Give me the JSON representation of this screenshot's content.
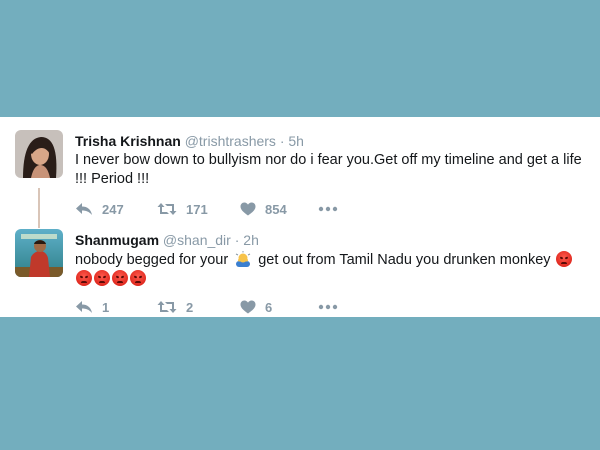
{
  "colors": {
    "background": "#73aebe",
    "card": "#ffffff",
    "name": "#14171a",
    "meta": "#8899a6",
    "thread_line": "#d9c5b8"
  },
  "tweets": [
    {
      "name": "Trisha Krishnan",
      "handle": "@trishtrashers",
      "separator": "·",
      "time": "5h",
      "text": "I never bow down to bullyism nor do i fear you.Get off my timeline and get a life !!! Period !!!",
      "replies": "247",
      "retweets": "171",
      "likes": "854",
      "avatar_icon": "profile-photo-icon"
    },
    {
      "name": "Shanmugam",
      "handle": "@shan_dir",
      "separator": "·",
      "time": "2h",
      "text_before_emoji": "nobody begged for your",
      "text_after_emoji": " get out from Tamil Nadu you drunken monkey",
      "emoji_begging": "person-bowing-emoji",
      "emoji_angry": "angry-face-emoji",
      "angry_count": 5,
      "replies": "1",
      "retweets": "2",
      "likes": "6",
      "avatar_icon": "movie-poster-icon"
    }
  ]
}
